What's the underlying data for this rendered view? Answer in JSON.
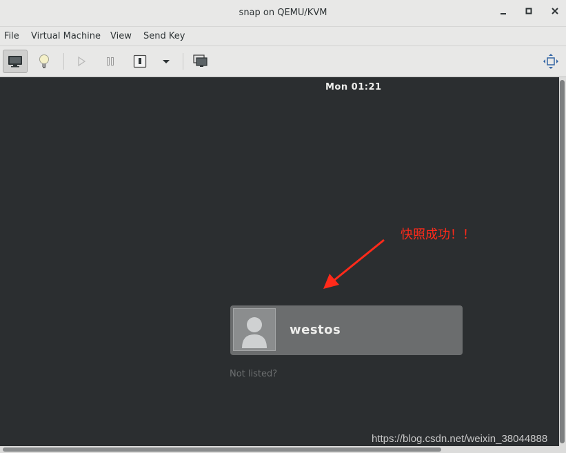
{
  "window": {
    "title": "snap on QEMU/KVM",
    "minimize_icon": "minimize-icon",
    "maximize_icon": "maximize-icon",
    "close_icon": "close-icon"
  },
  "menubar": {
    "items": [
      "File",
      "Virtual Machine",
      "View",
      "Send Key"
    ]
  },
  "toolbar": {
    "icons": [
      "monitor-icon",
      "lightbulb-icon",
      "play-icon",
      "pause-icon",
      "power-icon",
      "dropdown-icon",
      "screenshot-icon",
      "fullscreen-icon"
    ]
  },
  "guest": {
    "clock": "Mon 01:21",
    "annotation": "快照成功！！",
    "user_name": "westos",
    "not_listed": "Not listed?",
    "watermark": "https://blog.csdn.net/weixin_38044888"
  },
  "colors": {
    "annotation": "#ff2a1a",
    "guest_background": "#2b2e30",
    "user_card": "#6b6d6e"
  }
}
